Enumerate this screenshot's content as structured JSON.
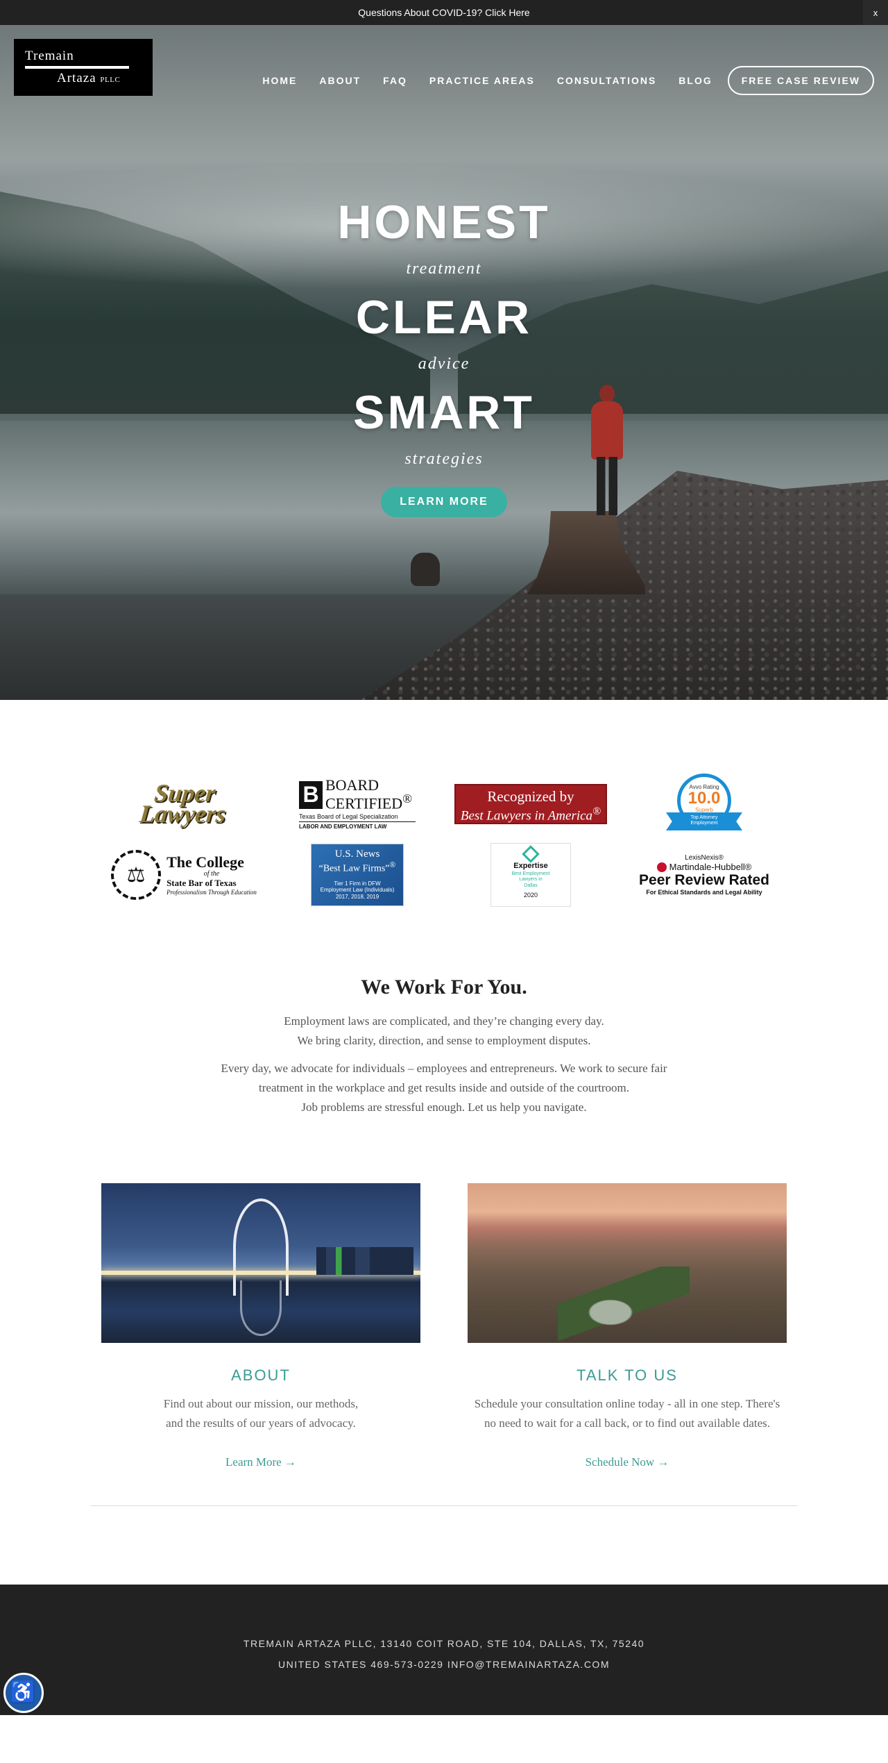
{
  "announcement": {
    "text": "Questions About COVID-19? Click Here",
    "close": "x"
  },
  "logo": {
    "line1": "Tremain",
    "line2": "Artaza",
    "suffix": "PLLC"
  },
  "nav": {
    "items": [
      "HOME",
      "ABOUT",
      "FAQ",
      "PRACTICE AREAS",
      "CONSULTATIONS",
      "BLOG"
    ],
    "cta": "FREE CASE REVIEW"
  },
  "hero": {
    "word1": "HONEST",
    "sub1": "treatment",
    "word2": "CLEAR",
    "sub2": "advice",
    "word3": "SMART",
    "sub3": "strategies",
    "button": "LEARN MORE",
    "button_color": "#39b0a2"
  },
  "badges": {
    "super_lawyers": {
      "line1": "Super",
      "line2": "Lawyers"
    },
    "board_certified": {
      "letter": "B",
      "word1": "BOARD",
      "word2": "CERTIFIED",
      "mark": "®",
      "org": "Texas Board of Legal Specialization",
      "area": "LABOR AND EMPLOYMENT LAW"
    },
    "best_lawyers": {
      "line1": "Recognized by",
      "line2": "Best Lawyers in America",
      "mark": "®"
    },
    "avvo": {
      "label": "Avvo Rating",
      "score": "10.0",
      "grade": "Superb",
      "ribbon1": "Top Attorney",
      "ribbon2": "Employment"
    },
    "college": {
      "title": "The College",
      "of_the": "of the",
      "state_bar": "State Bar of Texas",
      "tagline": "Professionalism Through Education"
    },
    "us_news": {
      "line1": "U.S. News",
      "line2": "“Best Law Firms”",
      "mark": "®",
      "detail1": "Tier 1 Firm in DFW",
      "detail2": "Employment Law (Individuals)",
      "years": "2017, 2018, 2019"
    },
    "expertise": {
      "name": "Expertise",
      "line1": "Best Employment",
      "line2": "Lawyers in",
      "line3": "Dallas",
      "year": "2020"
    },
    "martindale": {
      "lexis": "LexisNexis®",
      "name": "Martindale-Hubbell®",
      "headline": "Peer Review Rated",
      "subline": "For Ethical Standards and Legal Ability"
    }
  },
  "intro": {
    "heading": "We Work For You.",
    "p1_line1": "Employment laws are complicated, and they’re changing every day.",
    "p1_line2": "We bring clarity, direction, and sense to employment disputes.",
    "p2_line1": "Every day, we advocate for individuals – employees and entrepreneurs. We work to secure fair",
    "p2_line2": "treatment in the workplace and get results inside and outside of the courtroom.",
    "p2_line3": "Job problems are stressful enough. Let us help you navigate."
  },
  "cards": [
    {
      "title": "ABOUT",
      "line1": "Find out about our mission, our methods,",
      "line2": "and the results of our years of advocacy.",
      "link": "Learn More →"
    },
    {
      "title": "TALK TO US",
      "line1": "Schedule your consultation online today - all in one step. There's",
      "line2": "no need to wait for a call back, or to find out available dates.",
      "link": "Schedule Now →"
    }
  ],
  "footer": {
    "line1": "TREMAIN ARTAZA PLLC, 13140 COIT ROAD, STE 104, DALLAS, TX, 75240",
    "line2": "UNITED STATES 469-573-0229 INFO@TREMAINARTAZA.COM"
  },
  "accent_color": "#3a9b93"
}
